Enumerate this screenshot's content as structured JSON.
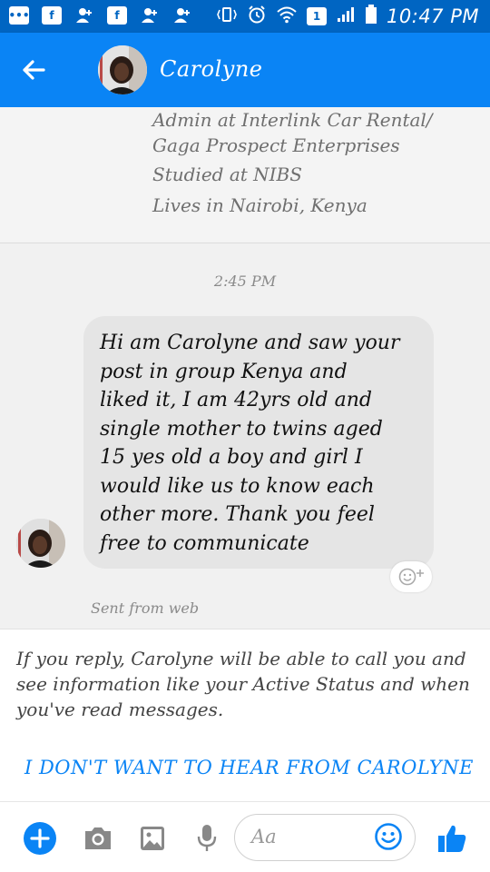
{
  "status_bar": {
    "time": "10:47 PM",
    "left_icons": [
      "messenger-notification-icon",
      "facebook-icon",
      "friend-request-icon",
      "facebook-icon",
      "friend-request-icon",
      "friend-request-icon"
    ],
    "sim_label": "1"
  },
  "header": {
    "contact_name": "Carolyne"
  },
  "profile": {
    "work": "Admin at Interlink Car Rental/",
    "work_cont": "Gaga Prospect Enterprises",
    "studied": "Studied at NIBS",
    "lives": "Lives in Nairobi, Kenya"
  },
  "conversation": {
    "timestamp": "2:45 PM",
    "message_lines": [
      "Hi am Carolyne and saw your",
      "post in group Kenya and",
      "liked it, I am 42yrs old and",
      "single mother to twins aged",
      "15 yes old a boy and girl I",
      "would like us to know each",
      "other more. Thank you feel",
      "free to communicate"
    ],
    "sent_from": "Sent from web"
  },
  "notice": {
    "text": "If you reply, Carolyne will be able to call you and see information like your Active Status and when you've read messages.",
    "no_hear_label": "I DON'T WANT TO HEAR FROM CAROLYNE"
  },
  "composer": {
    "placeholder": "Aa"
  },
  "colors": {
    "status_bar": "#0065c2",
    "header": "#0a84f5",
    "accent": "#0a84f5",
    "bubble": "#e5e5e5"
  }
}
